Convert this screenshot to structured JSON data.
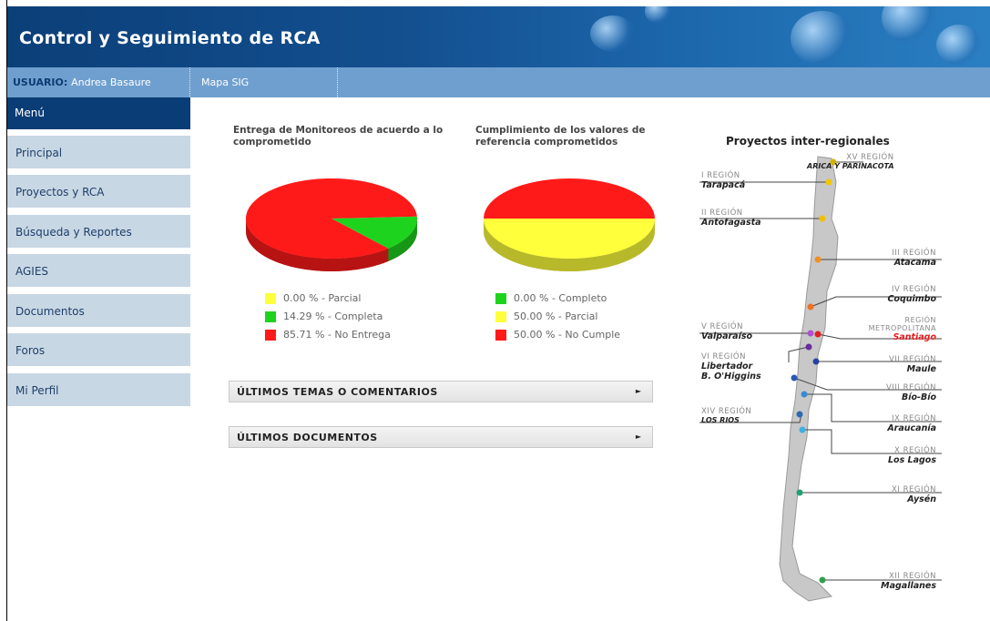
{
  "app": {
    "title": "Control y Seguimiento de RCA"
  },
  "userbar": {
    "user_label": "USUARIO:",
    "user_name": "Andrea Basaure",
    "map_link": "Mapa SIG"
  },
  "sidebar": {
    "header": "Menú",
    "items": [
      {
        "label": "Principal"
      },
      {
        "label": "Proyectos y RCA"
      },
      {
        "label": "Búsqueda y Reportes"
      },
      {
        "label": "AGIES"
      },
      {
        "label": "Documentos"
      },
      {
        "label": "Foros"
      },
      {
        "label": "Mi Perfil"
      }
    ]
  },
  "colors": {
    "red": "#ff1a1a",
    "green": "#1ed31e",
    "yellow": "#ffff3c",
    "navy": "#0a3c75",
    "sidebar": "#c8d7e4"
  },
  "chart_data": [
    {
      "type": "pie",
      "title": "Entrega de Monitoreos de acuerdo a lo comprometido",
      "labels": [
        "Parcial",
        "Completa",
        "No Entrega"
      ],
      "values": [
        0.0,
        14.29,
        85.71
      ],
      "legend": [
        "0.00 % - Parcial",
        "14.29 % - Completa",
        "85.71 % - No Entrega"
      ],
      "colors": [
        "#ffff3c",
        "#1ed31e",
        "#ff1a1a"
      ],
      "legend_position": "bottom"
    },
    {
      "type": "pie",
      "title": "Cumplimiento de los valores de referencia comprometidos",
      "labels": [
        "Completo",
        "Parcial",
        "No Cumple"
      ],
      "values": [
        0.0,
        50.0,
        50.0
      ],
      "legend": [
        "0.00 % - Completo",
        "50.00 % - Parcial",
        "50.00 % - No Cumple"
      ],
      "colors": [
        "#1ed31e",
        "#ffff3c",
        "#ff1a1a"
      ],
      "legend_position": "bottom"
    }
  ],
  "panels": {
    "topics": "ÚLTIMOS TEMAS O COMENTARIOS",
    "documents": "ÚLTIMOS DOCUMENTOS",
    "arrow": "►"
  },
  "map": {
    "title": "Proyectos inter-regionales",
    "regions": [
      {
        "num": "XV REGIÓN",
        "name": "ARICA Y PARINACOTA"
      },
      {
        "num": "I REGIÓN",
        "name": "Tarapacá"
      },
      {
        "num": "II REGIÓN",
        "name": "Antofagasta"
      },
      {
        "num": "III REGIÓN",
        "name": "Atacama"
      },
      {
        "num": "IV REGIÓN",
        "name": "Coquimbo"
      },
      {
        "num": "REGIÓN METROPOLITANA",
        "name": "Santiago"
      },
      {
        "num": "V REGIÓN",
        "name": "Valparaíso"
      },
      {
        "num": "VI REGIÓN",
        "name": "Libertador B. O'Higgins"
      },
      {
        "num": "VII REGIÓN",
        "name": "Maule"
      },
      {
        "num": "VIII REGIÓN",
        "name": "Bío-Bío"
      },
      {
        "num": "IX REGIÓN",
        "name": "Araucanía"
      },
      {
        "num": "XIV REGIÓN",
        "name": "LOS RIOS"
      },
      {
        "num": "X REGIÓN",
        "name": "Los Lagos"
      },
      {
        "num": "XI REGIÓN",
        "name": "Aysén"
      },
      {
        "num": "XII REGIÓN",
        "name": "Magallanes"
      }
    ]
  }
}
